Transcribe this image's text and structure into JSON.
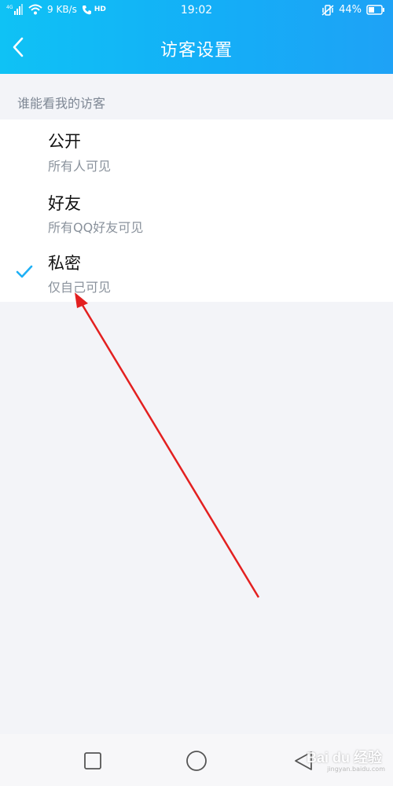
{
  "status_bar": {
    "network_type": "4G",
    "speed": "9 KB/s",
    "call_badge": "HD",
    "time": "19:02",
    "battery": "44%"
  },
  "header": {
    "title": "访客设置",
    "back_icon": "chevron-left-icon"
  },
  "section": {
    "label": "谁能看我的访客"
  },
  "options": [
    {
      "title": "公开",
      "subtitle": "所有人可见",
      "selected": false
    },
    {
      "title": "好友",
      "subtitle": "所有QQ好友可见",
      "selected": false
    },
    {
      "title": "私密",
      "subtitle": "仅自己可见",
      "selected": true
    }
  ],
  "colors": {
    "header_start": "#0fc2f5",
    "header_end": "#1ea2f6",
    "check": "#1fb0f5",
    "annotation_arrow": "#e32020",
    "background": "#f3f4f8"
  },
  "nav": {
    "recent_icon": "square-icon",
    "home_icon": "circle-icon",
    "back_icon": "triangle-back-icon"
  },
  "watermark": {
    "text": "Bai du 经验",
    "sub": "jingyan.baidu.com"
  }
}
